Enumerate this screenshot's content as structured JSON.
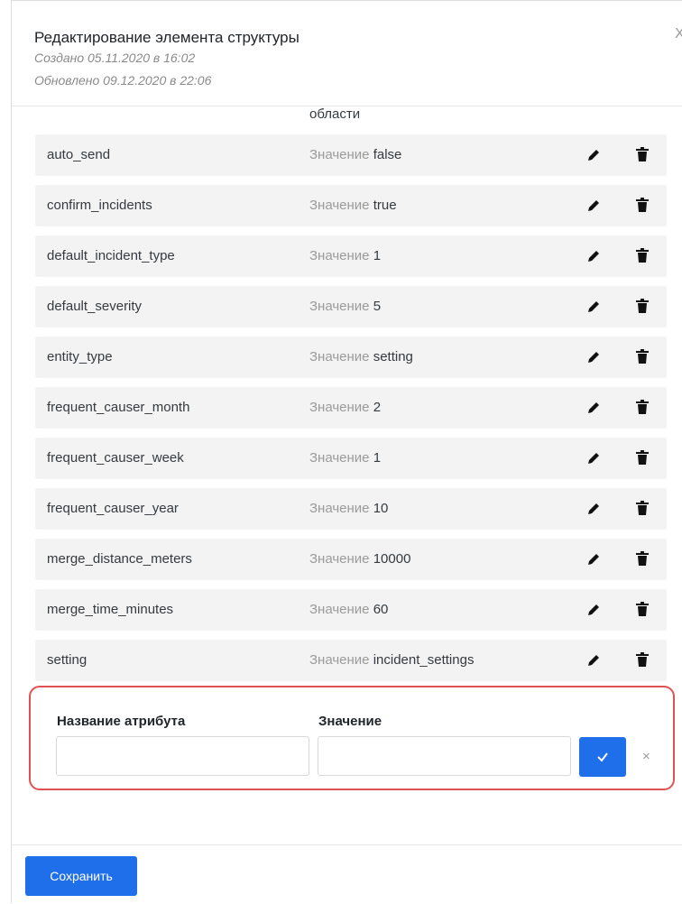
{
  "header": {
    "title": "Редактирование элемента структуры",
    "created": "Создано 05.11.2020 в 16:02",
    "updated": "Обновлено 09.12.2020 в 22:06",
    "close_glyph": "X"
  },
  "partial_text": "области",
  "attributes": [
    {
      "name": "auto_send",
      "value_label": "Значение",
      "value": "false"
    },
    {
      "name": "confirm_incidents",
      "value_label": "Значение",
      "value": "true"
    },
    {
      "name": "default_incident_type",
      "value_label": "Значение",
      "value": "1"
    },
    {
      "name": "default_severity",
      "value_label": "Значение",
      "value": "5"
    },
    {
      "name": "entity_type",
      "value_label": "Значение",
      "value": "setting"
    },
    {
      "name": "frequent_causer_month",
      "value_label": "Значение",
      "value": "2"
    },
    {
      "name": "frequent_causer_week",
      "value_label": "Значение",
      "value": "1"
    },
    {
      "name": "frequent_causer_year",
      "value_label": "Значение",
      "value": "10"
    },
    {
      "name": "merge_distance_meters",
      "value_label": "Значение",
      "value": "10000"
    },
    {
      "name": "merge_time_minutes",
      "value_label": "Значение",
      "value": "60"
    },
    {
      "name": "setting",
      "value_label": "Значение",
      "value": "incident_settings"
    }
  ],
  "new_attribute": {
    "name_label": "Название атрибута",
    "value_label": "Значение",
    "name_value": "",
    "value_value": "",
    "cancel_glyph": "×"
  },
  "footer": {
    "save_label": "Сохранить"
  },
  "colors": {
    "accent": "#1f6feb",
    "highlight_border": "#e05252",
    "row_bg": "#f3f3f3"
  }
}
